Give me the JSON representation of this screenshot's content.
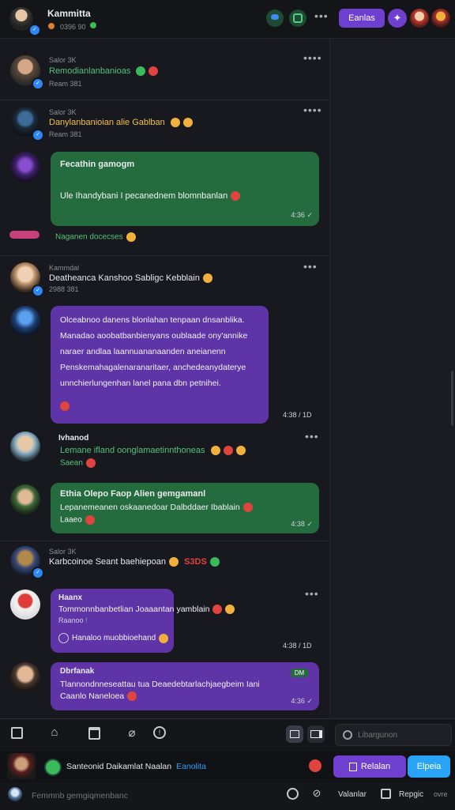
{
  "header": {
    "title": "Kammitta",
    "subtitle": "0396 90",
    "primary_button": "Eanlas"
  },
  "posts": [
    {
      "meta": "Salor 3K",
      "text": "Remodianlanbanioas",
      "time": "Ream 381"
    },
    {
      "meta": "Salor 3K",
      "text": "Danylanbanioian alie Gablban",
      "time": "Ream 381"
    }
  ],
  "bubble1": {
    "title": "Fecathin gamogm",
    "text": "Ule Ihandybani I pecanednem blomnbanlan",
    "time": "4:36"
  },
  "reaction1": "Naganen docecses",
  "post3": {
    "author": "Kammdal",
    "text": "Deatheanca Kanshoo Sabligc Kebblain",
    "time": "2988 381"
  },
  "bubble2": {
    "lines": [
      "Olceabnoo danens blonlahan tenpaan dnsanblika.",
      "Manadao aoobatbanbienyans oublaade ony'annike",
      "naraer andlaa laannuananaanden aneianenn",
      "Penskemahagalenaranaritaer, anchedeanydaterye",
      "unnchierlungenhan lanel pana dbn petnihei."
    ],
    "time": "4:38 / 1D"
  },
  "post4": {
    "author": "Ivhanod",
    "text": "Lemane ifland oonglamaetinnthoneas",
    "sub": "Saean"
  },
  "bubble3": {
    "title": "Ethia Olepo Faop Alien gemgamanl",
    "text": "Lepanemeanen oskaanedoar Dalbddaer Ibablain",
    "sub": "Laaeo",
    "time": "4:38"
  },
  "post5": {
    "meta": "Salor 3K",
    "text": "Karbcoinoe Seant baehiepoan",
    "badge": "S3DS"
  },
  "bubble4": {
    "title": "Haanx",
    "text": "Tommonnbanbetlian Joaaantan yamblain",
    "sub": "Raanoo",
    "link": "Hanaloo muobbioehand",
    "time": "4:38 / 1D"
  },
  "bubble5": {
    "title": "Dbrfanak",
    "text": "Tlannondnneseattau tua Deaedebtarlachjaegbeim Iani",
    "sub": "Caanlo Naneloea",
    "badge": "DM",
    "time": "4:36"
  },
  "search": {
    "placeholder": "Libargunon"
  },
  "bottom_bar": {
    "status_text": "Santeonid Daikamlat Naalan",
    "status_link": "Eanolita",
    "action_primary": "Relalan",
    "action_secondary": "Elpeia",
    "compose_placeholder": "Femmnb gemgiqmenbanc",
    "footer_link1": "Valanlar",
    "footer_link2": "Repgic",
    "footer_link3": "ovre"
  },
  "colors": {
    "accent_purple": "#6f3fd0",
    "accent_green": "#246c3d",
    "accent_blue": "#29a3f5"
  }
}
